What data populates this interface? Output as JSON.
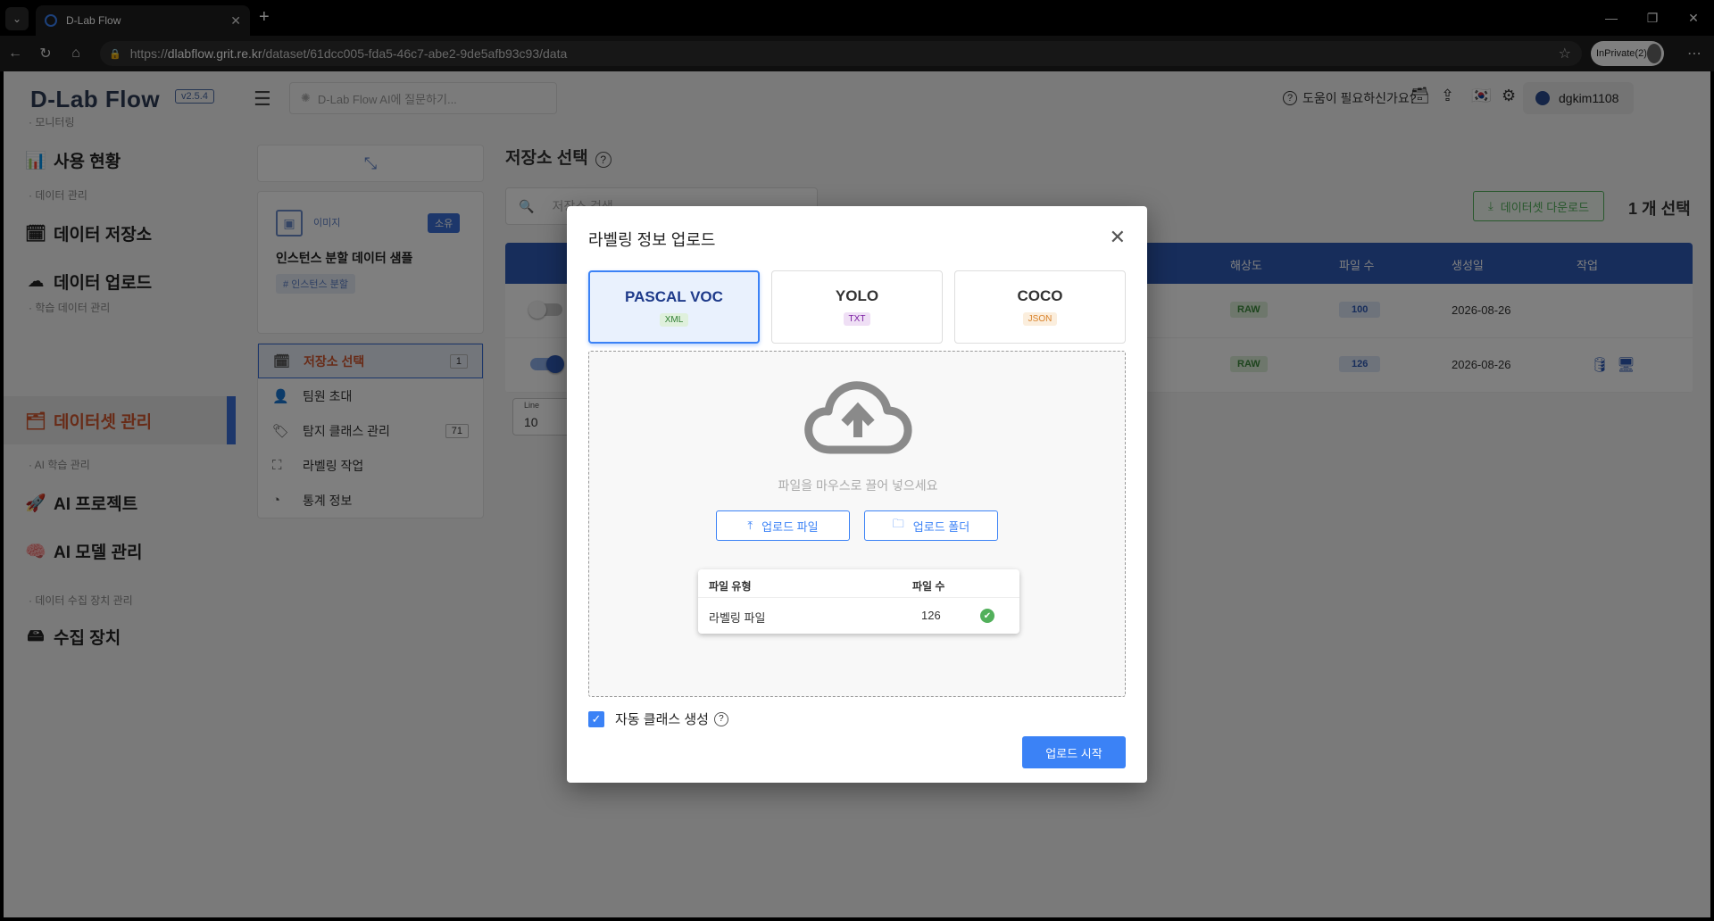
{
  "browser": {
    "tab_title": "D-Lab Flow",
    "url_prefix": "https://",
    "url_host": "dlabflow.grit.re.kr",
    "url_path": "/dataset/61dcc005-fda5-46c7-abe2-9de5afb93c93/data",
    "inprivate_label": "InPrivate(2)"
  },
  "sidebar": {
    "logo": "D-Lab Flow",
    "version": "v2.5.4",
    "sections": {
      "monitoring": "· 모니터링",
      "data_mgmt": "· 데이터 관리",
      "train_data_mgmt": "· 학습 데이터 관리",
      "ai_train_mgmt": "· AI 학습 관리",
      "device_mgmt": "· 데이터 수집 장치 관리"
    },
    "items": {
      "usage": "사용 현황",
      "data_storage": "데이터 저장소",
      "data_upload": "데이터 업로드",
      "dataset_mgmt": "데이터셋 관리",
      "ai_project": "AI 프로젝트",
      "ai_model": "AI 모델 관리",
      "collect_device": "수집 장치"
    }
  },
  "topbar": {
    "ai_placeholder": "D-Lab Flow AI에 질문하기...",
    "help": "도움이 필요하신가요?",
    "username": "dgkim1108"
  },
  "left_panel": {
    "dataset_type": "이미지",
    "owner_badge": "소유",
    "dataset_name": "인스턴스 분할 데이터 샘플",
    "tag": "인스턴스 분할",
    "menu": [
      {
        "label": "저장소 선택",
        "count": "1"
      },
      {
        "label": "팀원 초대"
      },
      {
        "label": "탐지 클래스 관리",
        "count": "71"
      },
      {
        "label": "라벨링 작업"
      },
      {
        "label": "통계 정보"
      }
    ]
  },
  "main": {
    "title": "저장소 선택",
    "search_placeholder": "저장소 검색",
    "download_btn": "데이터셋 다운로드",
    "selected_count": "1 개 선택",
    "columns": {
      "resolution": "해상도",
      "file_count": "파일 수",
      "created": "생성일",
      "action": "작업"
    },
    "rows": [
      {
        "resolution": "RAW",
        "files": "100",
        "date": "2026-08-26",
        "on": false
      },
      {
        "resolution": "RAW",
        "files": "126",
        "date": "2026-08-26",
        "on": true
      }
    ],
    "pager_label": "Line",
    "pager_value": "10"
  },
  "modal": {
    "title": "라벨링 정보 업로드",
    "formats": [
      {
        "name": "PASCAL VOC",
        "ext": "XML",
        "ext_color": "#2e7d32",
        "ext_bg": "#dff0dc"
      },
      {
        "name": "YOLO",
        "ext": "TXT",
        "ext_color": "#7b1fa2",
        "ext_bg": "#efdff5"
      },
      {
        "name": "COCO",
        "ext": "JSON",
        "ext_color": "#d9822b",
        "ext_bg": "#fbeedd"
      }
    ],
    "drop_hint": "파일을 마우스로 끌어 넣으세요",
    "upload_file": "업로드 파일",
    "upload_folder": "업로드 폴더",
    "file_table": {
      "col_type": "파일 유형",
      "col_count": "파일 수",
      "row_type": "라벨링 파일",
      "row_count": "126"
    },
    "auto_class": "자동 클래스 생성",
    "start": "업로드 시작"
  }
}
